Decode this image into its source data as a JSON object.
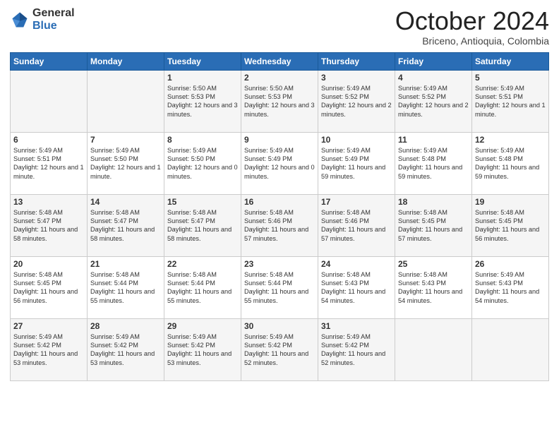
{
  "logo": {
    "general": "General",
    "blue": "Blue"
  },
  "header": {
    "month": "October 2024",
    "location": "Briceno, Antioquia, Colombia"
  },
  "days": [
    "Sunday",
    "Monday",
    "Tuesday",
    "Wednesday",
    "Thursday",
    "Friday",
    "Saturday"
  ],
  "weeks": [
    [
      {
        "day": "",
        "content": ""
      },
      {
        "day": "",
        "content": ""
      },
      {
        "day": "1",
        "content": "Sunrise: 5:50 AM\nSunset: 5:53 PM\nDaylight: 12 hours and 3 minutes."
      },
      {
        "day": "2",
        "content": "Sunrise: 5:50 AM\nSunset: 5:53 PM\nDaylight: 12 hours and 3 minutes."
      },
      {
        "day": "3",
        "content": "Sunrise: 5:49 AM\nSunset: 5:52 PM\nDaylight: 12 hours and 2 minutes."
      },
      {
        "day": "4",
        "content": "Sunrise: 5:49 AM\nSunset: 5:52 PM\nDaylight: 12 hours and 2 minutes."
      },
      {
        "day": "5",
        "content": "Sunrise: 5:49 AM\nSunset: 5:51 PM\nDaylight: 12 hours and 1 minute."
      }
    ],
    [
      {
        "day": "6",
        "content": "Sunrise: 5:49 AM\nSunset: 5:51 PM\nDaylight: 12 hours and 1 minute."
      },
      {
        "day": "7",
        "content": "Sunrise: 5:49 AM\nSunset: 5:50 PM\nDaylight: 12 hours and 1 minute."
      },
      {
        "day": "8",
        "content": "Sunrise: 5:49 AM\nSunset: 5:50 PM\nDaylight: 12 hours and 0 minutes."
      },
      {
        "day": "9",
        "content": "Sunrise: 5:49 AM\nSunset: 5:49 PM\nDaylight: 12 hours and 0 minutes."
      },
      {
        "day": "10",
        "content": "Sunrise: 5:49 AM\nSunset: 5:49 PM\nDaylight: 11 hours and 59 minutes."
      },
      {
        "day": "11",
        "content": "Sunrise: 5:49 AM\nSunset: 5:48 PM\nDaylight: 11 hours and 59 minutes."
      },
      {
        "day": "12",
        "content": "Sunrise: 5:49 AM\nSunset: 5:48 PM\nDaylight: 11 hours and 59 minutes."
      }
    ],
    [
      {
        "day": "13",
        "content": "Sunrise: 5:48 AM\nSunset: 5:47 PM\nDaylight: 11 hours and 58 minutes."
      },
      {
        "day": "14",
        "content": "Sunrise: 5:48 AM\nSunset: 5:47 PM\nDaylight: 11 hours and 58 minutes."
      },
      {
        "day": "15",
        "content": "Sunrise: 5:48 AM\nSunset: 5:47 PM\nDaylight: 11 hours and 58 minutes."
      },
      {
        "day": "16",
        "content": "Sunrise: 5:48 AM\nSunset: 5:46 PM\nDaylight: 11 hours and 57 minutes."
      },
      {
        "day": "17",
        "content": "Sunrise: 5:48 AM\nSunset: 5:46 PM\nDaylight: 11 hours and 57 minutes."
      },
      {
        "day": "18",
        "content": "Sunrise: 5:48 AM\nSunset: 5:45 PM\nDaylight: 11 hours and 57 minutes."
      },
      {
        "day": "19",
        "content": "Sunrise: 5:48 AM\nSunset: 5:45 PM\nDaylight: 11 hours and 56 minutes."
      }
    ],
    [
      {
        "day": "20",
        "content": "Sunrise: 5:48 AM\nSunset: 5:45 PM\nDaylight: 11 hours and 56 minutes."
      },
      {
        "day": "21",
        "content": "Sunrise: 5:48 AM\nSunset: 5:44 PM\nDaylight: 11 hours and 55 minutes."
      },
      {
        "day": "22",
        "content": "Sunrise: 5:48 AM\nSunset: 5:44 PM\nDaylight: 11 hours and 55 minutes."
      },
      {
        "day": "23",
        "content": "Sunrise: 5:48 AM\nSunset: 5:44 PM\nDaylight: 11 hours and 55 minutes."
      },
      {
        "day": "24",
        "content": "Sunrise: 5:48 AM\nSunset: 5:43 PM\nDaylight: 11 hours and 54 minutes."
      },
      {
        "day": "25",
        "content": "Sunrise: 5:48 AM\nSunset: 5:43 PM\nDaylight: 11 hours and 54 minutes."
      },
      {
        "day": "26",
        "content": "Sunrise: 5:49 AM\nSunset: 5:43 PM\nDaylight: 11 hours and 54 minutes."
      }
    ],
    [
      {
        "day": "27",
        "content": "Sunrise: 5:49 AM\nSunset: 5:42 PM\nDaylight: 11 hours and 53 minutes."
      },
      {
        "day": "28",
        "content": "Sunrise: 5:49 AM\nSunset: 5:42 PM\nDaylight: 11 hours and 53 minutes."
      },
      {
        "day": "29",
        "content": "Sunrise: 5:49 AM\nSunset: 5:42 PM\nDaylight: 11 hours and 53 minutes."
      },
      {
        "day": "30",
        "content": "Sunrise: 5:49 AM\nSunset: 5:42 PM\nDaylight: 11 hours and 52 minutes."
      },
      {
        "day": "31",
        "content": "Sunrise: 5:49 AM\nSunset: 5:42 PM\nDaylight: 11 hours and 52 minutes."
      },
      {
        "day": "",
        "content": ""
      },
      {
        "day": "",
        "content": ""
      }
    ]
  ]
}
